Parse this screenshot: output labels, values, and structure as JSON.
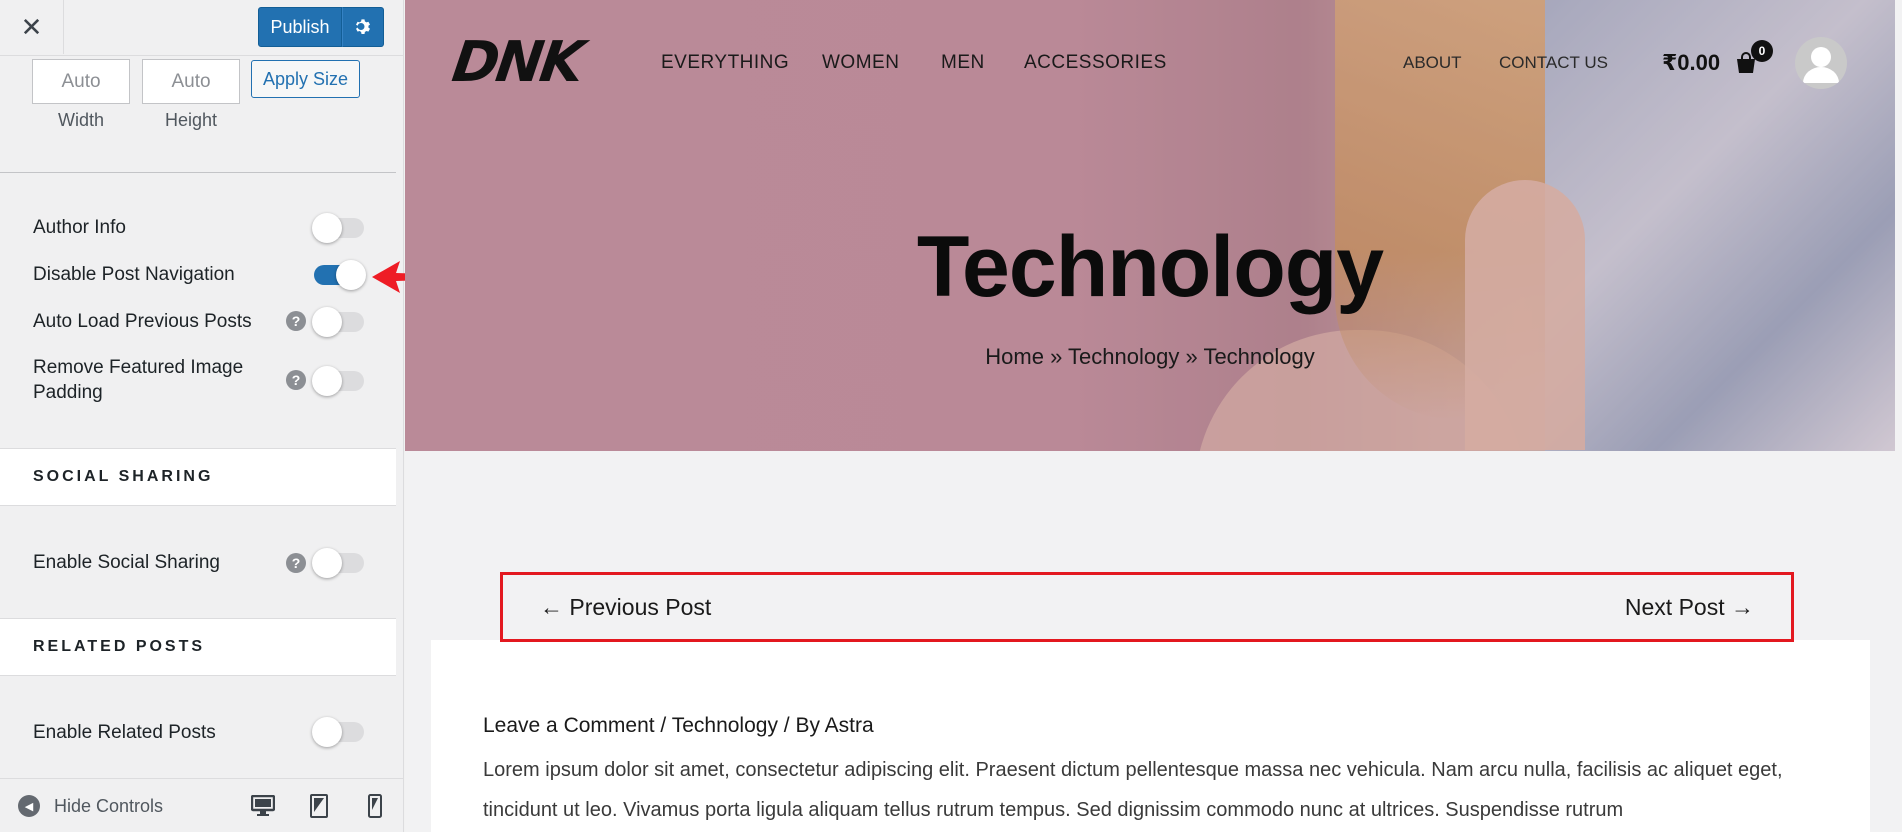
{
  "customizer": {
    "publish_label": "Publish",
    "size": {
      "width_value": "Auto",
      "height_value": "Auto",
      "width_label": "Width",
      "height_label": "Height",
      "apply_label": "Apply Size"
    },
    "options": [
      {
        "label": "Author Info",
        "on": false,
        "help": false
      },
      {
        "label": "Disable Post Navigation",
        "on": true,
        "help": false
      },
      {
        "label": "Auto Load Previous Posts",
        "on": false,
        "help": true
      },
      {
        "label": "Remove Featured Image Padding",
        "on": false,
        "help": true
      }
    ],
    "sections": {
      "social_sharing": "SOCIAL SHARING",
      "social_sharing_option": "Enable Social Sharing",
      "related_posts": "RELATED POSTS",
      "related_posts_option": "Enable Related Posts"
    },
    "footer": {
      "hide_controls": "Hide Controls"
    },
    "accent_color": "#2271b1"
  },
  "site": {
    "logo": "DNK",
    "nav": [
      "EVERYTHING",
      "WOMEN",
      "MEN",
      "ACCESSORIES"
    ],
    "nav_secondary": [
      "ABOUT",
      "CONTACT US"
    ],
    "cart_total": "₹0.00",
    "cart_count": "0",
    "hero_title": "Technology",
    "breadcrumb": [
      "Home",
      "Technology",
      "Technology"
    ],
    "breadcrumb_separator": "»",
    "prev_post": "← Previous Post",
    "next_post": "Next Post →",
    "meta": "Leave a Comment / Technology / By Astra",
    "body": "Lorem ipsum dolor sit amet, consectetur adipiscing elit. Praesent dictum pellentesque massa nec vehicula. Nam arcu nulla, facilisis ac aliquet eget, tincidunt ut leo. Vivamus porta ligula aliquam tellus rutrum tempus. Sed dignissim commodo nunc at ultrices. Suspendisse rutrum",
    "highlight_color": "#e3181f"
  }
}
